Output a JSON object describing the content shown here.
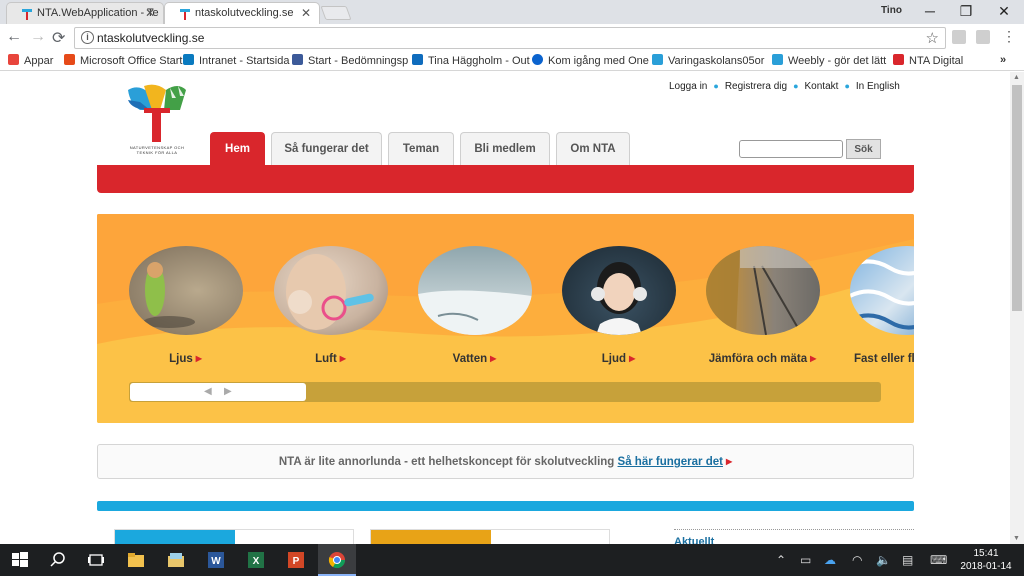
{
  "browser": {
    "tabs": [
      {
        "title": "NTA.WebApplication - Te"
      },
      {
        "title": "ntaskolutveckling.se"
      }
    ],
    "profile_name": "Tino",
    "url": "ntaskolutveckling.se",
    "bookmarks": [
      {
        "label": "Appar",
        "icon": "apps-grid-icon",
        "color": "#e8453c"
      },
      {
        "label": "Microsoft Office Start",
        "icon": "office-icon",
        "color": "#e64a19"
      },
      {
        "label": "Intranet - Startsida",
        "icon": "sharepoint-icon",
        "color": "#0a7abf"
      },
      {
        "label": "Start - Bedömningsp",
        "icon": "page-icon",
        "color": "#3c5a99"
      },
      {
        "label": "Tina Häggholm - Out",
        "icon": "outlook-icon",
        "color": "#0f6cbd"
      },
      {
        "label": "Kom igång med One",
        "icon": "onedrive-icon",
        "color": "#0b63ce"
      },
      {
        "label": "Varingaskolans05or",
        "icon": "weebly-icon",
        "color": "#2a9fd8"
      },
      {
        "label": "Weebly - gör det lätt",
        "icon": "weebly-icon",
        "color": "#2a9fd8"
      },
      {
        "label": "NTA Digital",
        "icon": "nta-icon",
        "color": "#d9262c"
      }
    ],
    "more_bookmarks": "»"
  },
  "site": {
    "top_links": [
      "Logga in",
      "Registrera dig",
      "Kontakt",
      "In English"
    ],
    "logo_text": "NATURVETENSKAP OCH TEKNIK FÖR ALLA",
    "nav": [
      "Hem",
      "Så fungerar det",
      "Teman",
      "Bli medlem",
      "Om NTA"
    ],
    "search_button": "Sök",
    "themes": [
      {
        "label": "Ljus"
      },
      {
        "label": "Luft"
      },
      {
        "label": "Vatten"
      },
      {
        "label": "Ljud"
      },
      {
        "label": "Jämföra och mäta"
      },
      {
        "label": "Fast eller fl"
      }
    ],
    "info_text": "NTA är lite annorlunda - ett helhetskoncept för skolutveckling",
    "info_link": "Så här fungerar det",
    "news_heading": "Aktuellt"
  },
  "taskbar": {
    "time": "15:41",
    "date": "2018-01-14"
  },
  "colors": {
    "brand_red": "#d9262c",
    "carousel_orange": "#fcc247",
    "accent_blue": "#1ba8de"
  }
}
